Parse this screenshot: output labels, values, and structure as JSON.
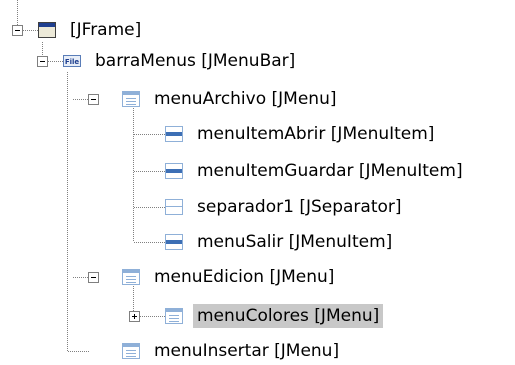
{
  "tree": {
    "nodes": [
      {
        "label": "[JFrame]",
        "icon": "frame-icon",
        "expander": "minus",
        "selected": false
      },
      {
        "label": "barraMenus [JMenuBar]",
        "icon": "file-menubar-icon",
        "expander": "minus",
        "selected": false
      },
      {
        "label": "menuArchivo [JMenu]",
        "icon": "menu-icon",
        "expander": "minus",
        "selected": false
      },
      {
        "label": "menuItemAbrir [JMenuItem]",
        "icon": "menu-item-icon",
        "expander": "none",
        "selected": false
      },
      {
        "label": "menuItemGuardar [JMenuItem]",
        "icon": "menu-item-icon",
        "expander": "none",
        "selected": false
      },
      {
        "label": "separador1 [JSeparator]",
        "icon": "separator-icon",
        "expander": "none",
        "selected": false
      },
      {
        "label": "menuSalir [JMenuItem]",
        "icon": "menu-item-icon",
        "expander": "none",
        "selected": false
      },
      {
        "label": "menuEdicion [JMenu]",
        "icon": "menu-icon",
        "expander": "minus",
        "selected": false
      },
      {
        "label": "menuColores [JMenu]",
        "icon": "menu-icon",
        "expander": "plus",
        "selected": true
      },
      {
        "label": "menuInsertar [JMenu]",
        "icon": "menu-icon",
        "expander": "none",
        "selected": false
      }
    ],
    "file_icon_text": "File",
    "colors": {
      "selection": "#c8c8c8",
      "connector": "#808080",
      "menu_icon_blue": "#8fb0d8",
      "item_bar_blue": "#3d6fb5",
      "frame_titlebar": "#1f3f8f"
    }
  }
}
